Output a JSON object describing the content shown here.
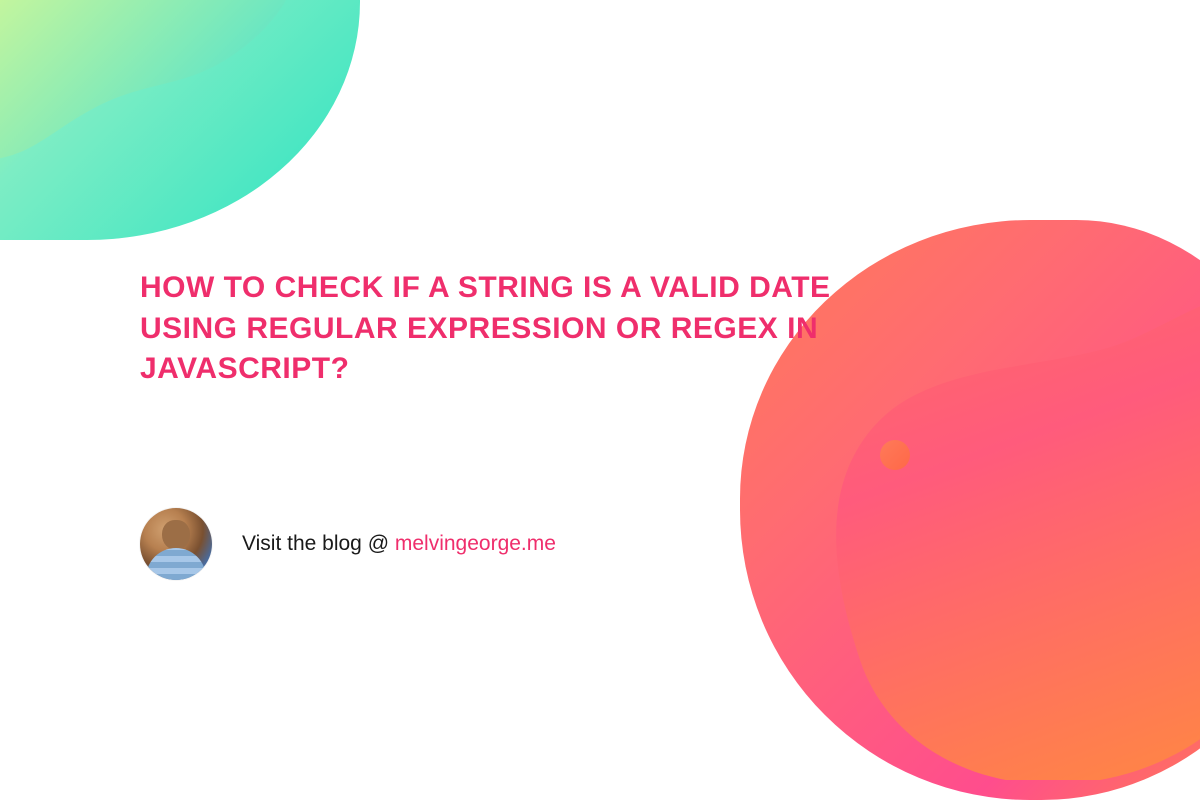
{
  "headline": "HOW TO CHECK IF A STRING IS A VALID DATE USING REGULAR EXPRESSION OR REGEX IN JAVASCRIPT?",
  "footer": {
    "prefix": "Visit the blog @ ",
    "link_text": "melvingeorge.me"
  },
  "colors": {
    "accent": "#ef2e6c"
  }
}
